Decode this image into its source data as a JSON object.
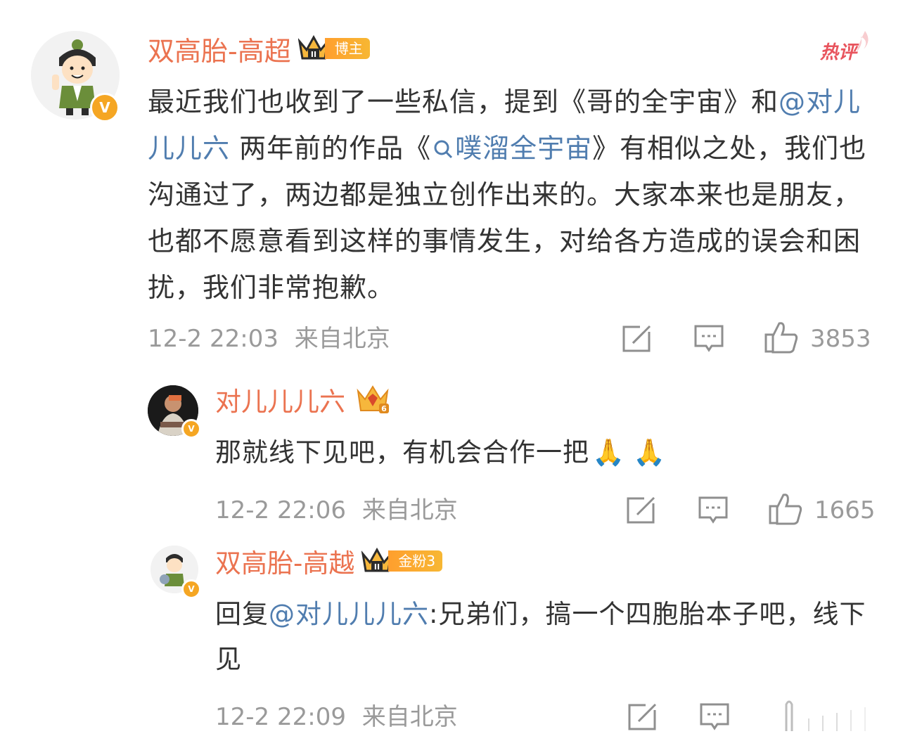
{
  "hot_badge": "热评",
  "comments": [
    {
      "author": "双高胎-高超",
      "badge_label": "博主",
      "badge_level": "II",
      "content_part1": "最近我们也收到了一些私信，提到《哥的全宇宙》和",
      "mention": "@对儿儿儿六",
      "content_part2": " 两年前的作品《",
      "search_link": "噗溜全宇宙",
      "content_part3": "》有相似之处，我们也沟通过了，两边都是独立创作出来的。大家本来也是朋友，也都不愿意看到这样的事情发生，对给各方造成的误会和困扰，我们非常抱歉。",
      "time": "12-2 22:03",
      "location": "来自北京",
      "likes": "3853"
    },
    {
      "author": "对儿儿儿六",
      "badge_level": "6",
      "content": "那就线下见吧，有机会合作一把",
      "emoji": "🙏🙏",
      "time": "12-2 22:06",
      "location": "来自北京",
      "likes": "1665"
    },
    {
      "author": "双高胎-高越",
      "badge_label": "金粉3",
      "badge_level": "II",
      "reply_prefix": "回复",
      "mention": "@对儿儿儿六",
      "content": ":兄弟们，搞一个四胞胎本子吧，线下见",
      "time": "12-2 22:09",
      "location": "来自北京"
    }
  ],
  "colors": {
    "name": "#eb7350",
    "mention": "#507daf",
    "meta": "#9a9a9a",
    "verified": "#f5a623",
    "hot": "#e8545d"
  }
}
